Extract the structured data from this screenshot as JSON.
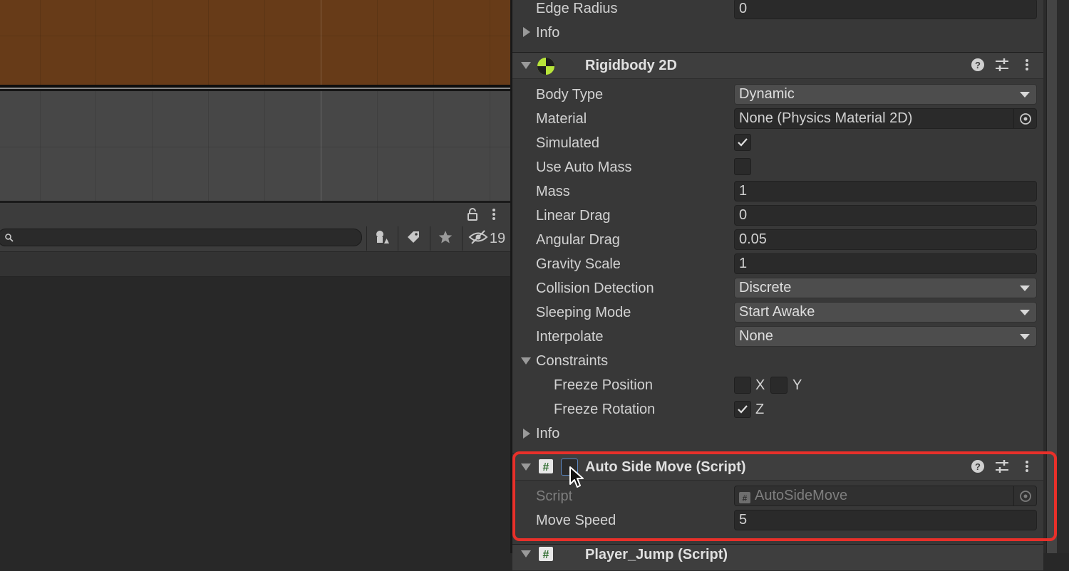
{
  "hierarchy": {
    "search_placeholder": "",
    "hidden_count": "19",
    "icons": [
      "lock-icon",
      "kebab-menu-icon",
      "search-icon",
      "shapes-filter-icon",
      "label-tag-icon",
      "favorite-star-icon",
      "hidden-eye-icon"
    ]
  },
  "inspector": {
    "collider_partial": {
      "edge_radius_label": "Edge Radius",
      "edge_radius_value": "0",
      "info_label": "Info"
    },
    "rigidbody": {
      "title": "Rigidbody 2D",
      "body_type_label": "Body Type",
      "body_type_value": "Dynamic",
      "material_label": "Material",
      "material_value": "None (Physics Material 2D)",
      "simulated_label": "Simulated",
      "simulated_checked": true,
      "use_auto_mass_label": "Use Auto Mass",
      "use_auto_mass_checked": false,
      "mass_label": "Mass",
      "mass_value": "1",
      "linear_drag_label": "Linear Drag",
      "linear_drag_value": "0",
      "angular_drag_label": "Angular Drag",
      "angular_drag_value": "0.05",
      "gravity_scale_label": "Gravity Scale",
      "gravity_scale_value": "1",
      "collision_detection_label": "Collision Detection",
      "collision_detection_value": "Discrete",
      "sleeping_mode_label": "Sleeping Mode",
      "sleeping_mode_value": "Start Awake",
      "interpolate_label": "Interpolate",
      "interpolate_value": "None",
      "constraints_label": "Constraints",
      "freeze_position_label": "Freeze Position",
      "freeze_position_x_label": "X",
      "freeze_position_y_label": "Y",
      "freeze_rotation_label": "Freeze Rotation",
      "freeze_rotation_z_label": "Z",
      "info_label": "Info"
    },
    "auto_side_move": {
      "title": "Auto Side Move (Script)",
      "script_label": "Script",
      "script_value": "AutoSideMove",
      "move_speed_label": "Move Speed",
      "move_speed_value": "5",
      "enabled": false
    },
    "next_component": {
      "title": "Player_Jump (Script)"
    }
  },
  "colors": {
    "highlight": "#e8302a",
    "ground": "#673b18",
    "rigidbody_icon": "#b7e43a"
  }
}
